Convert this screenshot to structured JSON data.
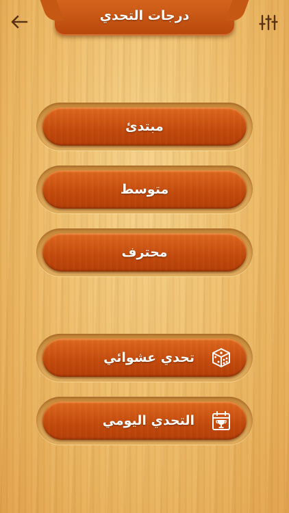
{
  "header": {
    "title": "درجات التحدي"
  },
  "levels": [
    {
      "label": "مبتدئ"
    },
    {
      "label": "متوسط"
    },
    {
      "label": "محترف"
    }
  ],
  "challenges": [
    {
      "label": "تحدي عشوائي",
      "icon": "dice-icon"
    },
    {
      "label": "التحدي اليومي",
      "icon": "calendar-trophy-icon"
    }
  ],
  "colors": {
    "button": "#c8500f",
    "header": "#c5561a",
    "text": "#ffffff"
  }
}
